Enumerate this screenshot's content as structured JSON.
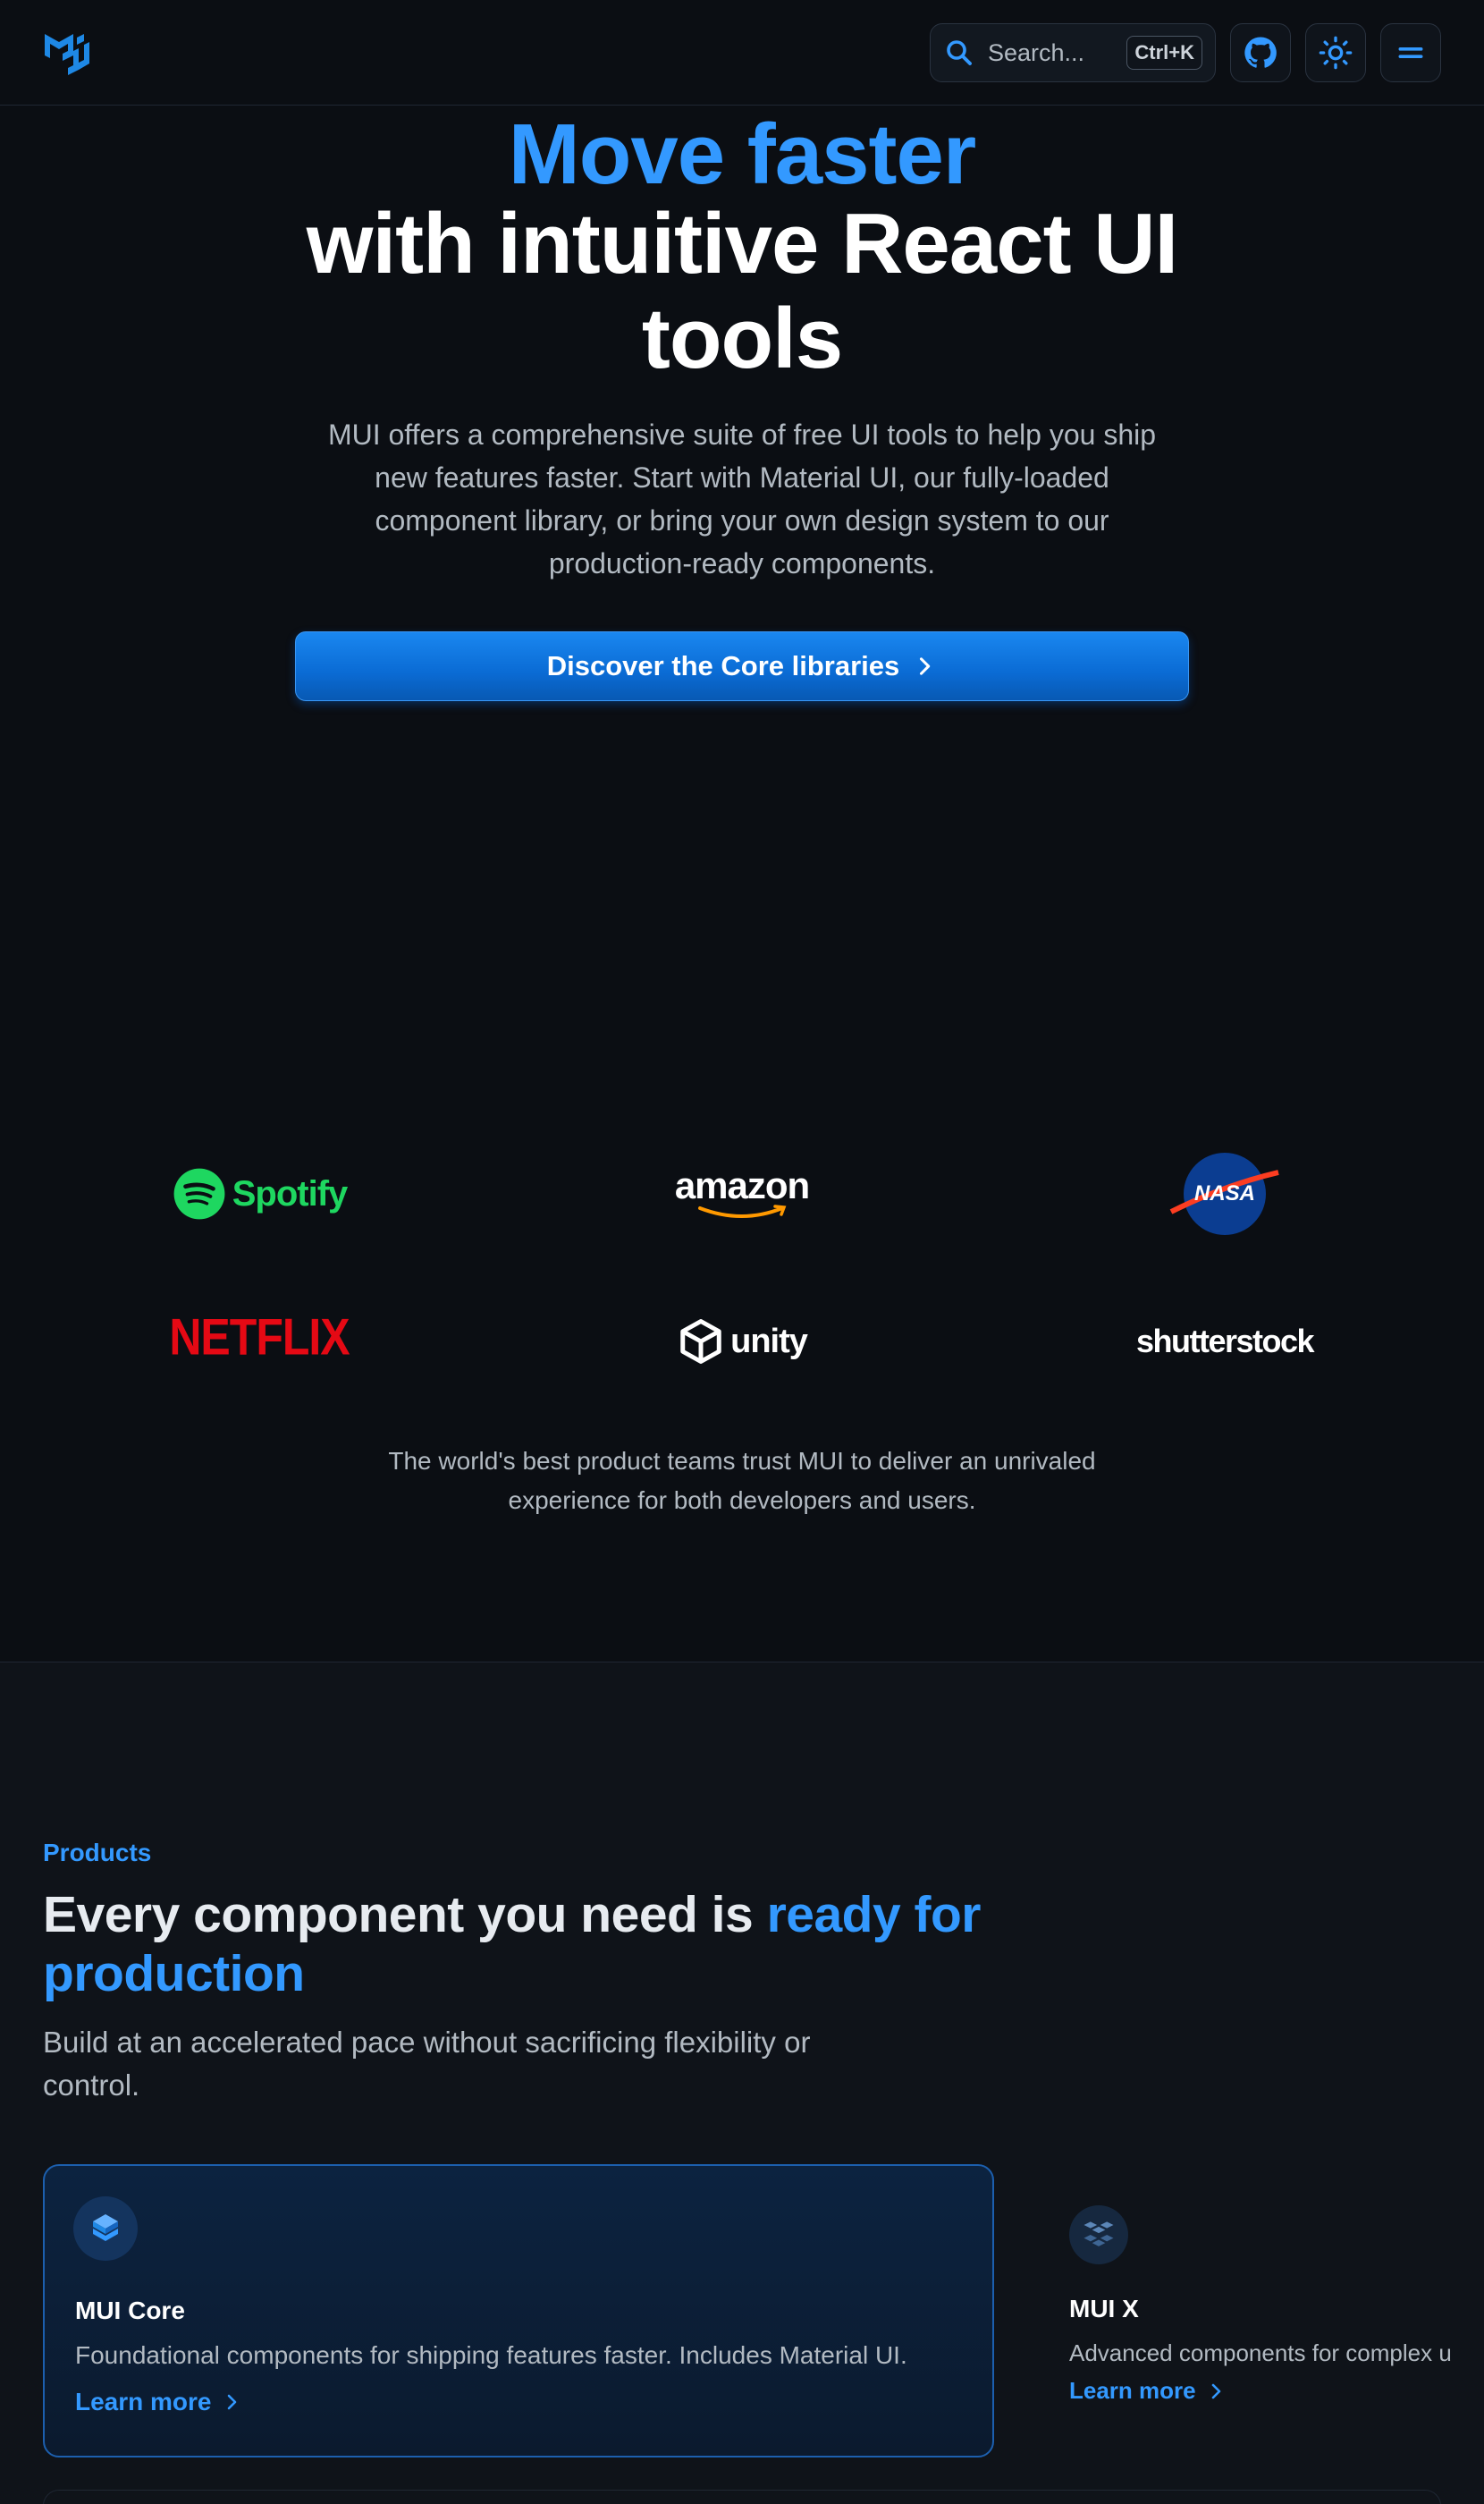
{
  "header": {
    "search_placeholder": "Search...",
    "search_shortcut": "Ctrl+K",
    "icons": [
      "mui-logo-icon",
      "search-icon",
      "github-icon",
      "sun-icon",
      "menu-icon"
    ]
  },
  "hero": {
    "title_accent": "Move faster",
    "title_rest": "with intuitive React UI tools",
    "description": "MUI offers a comprehensive suite of free UI tools to help you ship new features faster. Start with Material UI, our fully-loaded component library, or bring your own design system to our production-ready components.",
    "cta_label": "Discover the Core libraries"
  },
  "logos": [
    "Spotify",
    "amazon",
    "NASA",
    "NETFLIX",
    "unity",
    "shutterstock"
  ],
  "trust_text": "The world's best product teams trust MUI to deliver an unrivaled experience for both developers and users.",
  "products": {
    "overline": "Products",
    "title_plain": "Every component you need is ",
    "title_accent": "ready for production",
    "description": "Build at an accelerated pace without sacrificing flexibility or control.",
    "cards": [
      {
        "title": "MUI Core",
        "description": "Foundational components for shipping features faster. Includes Material UI.",
        "link": "Learn more"
      },
      {
        "title": "MUI X",
        "description": "Advanced components for complex u",
        "link": "Learn more"
      }
    ]
  },
  "colors": {
    "background": "#0b0e13",
    "accent": "#3399ff",
    "cta": "#0a6bd4",
    "spotify": "#1ed760",
    "netflix": "#e50914"
  }
}
